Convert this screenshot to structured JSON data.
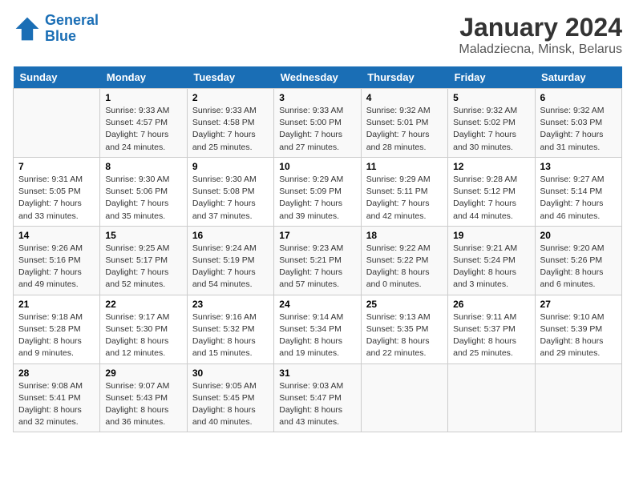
{
  "logo": {
    "line1": "General",
    "line2": "Blue"
  },
  "title": "January 2024",
  "subtitle": "Maladziecna, Minsk, Belarus",
  "days_of_week": [
    "Sunday",
    "Monday",
    "Tuesday",
    "Wednesday",
    "Thursday",
    "Friday",
    "Saturday"
  ],
  "weeks": [
    [
      {
        "day": "",
        "sunrise": "",
        "sunset": "",
        "daylight": ""
      },
      {
        "day": "1",
        "sunrise": "Sunrise: 9:33 AM",
        "sunset": "Sunset: 4:57 PM",
        "daylight": "Daylight: 7 hours and 24 minutes."
      },
      {
        "day": "2",
        "sunrise": "Sunrise: 9:33 AM",
        "sunset": "Sunset: 4:58 PM",
        "daylight": "Daylight: 7 hours and 25 minutes."
      },
      {
        "day": "3",
        "sunrise": "Sunrise: 9:33 AM",
        "sunset": "Sunset: 5:00 PM",
        "daylight": "Daylight: 7 hours and 27 minutes."
      },
      {
        "day": "4",
        "sunrise": "Sunrise: 9:32 AM",
        "sunset": "Sunset: 5:01 PM",
        "daylight": "Daylight: 7 hours and 28 minutes."
      },
      {
        "day": "5",
        "sunrise": "Sunrise: 9:32 AM",
        "sunset": "Sunset: 5:02 PM",
        "daylight": "Daylight: 7 hours and 30 minutes."
      },
      {
        "day": "6",
        "sunrise": "Sunrise: 9:32 AM",
        "sunset": "Sunset: 5:03 PM",
        "daylight": "Daylight: 7 hours and 31 minutes."
      }
    ],
    [
      {
        "day": "7",
        "sunrise": "Sunrise: 9:31 AM",
        "sunset": "Sunset: 5:05 PM",
        "daylight": "Daylight: 7 hours and 33 minutes."
      },
      {
        "day": "8",
        "sunrise": "Sunrise: 9:30 AM",
        "sunset": "Sunset: 5:06 PM",
        "daylight": "Daylight: 7 hours and 35 minutes."
      },
      {
        "day": "9",
        "sunrise": "Sunrise: 9:30 AM",
        "sunset": "Sunset: 5:08 PM",
        "daylight": "Daylight: 7 hours and 37 minutes."
      },
      {
        "day": "10",
        "sunrise": "Sunrise: 9:29 AM",
        "sunset": "Sunset: 5:09 PM",
        "daylight": "Daylight: 7 hours and 39 minutes."
      },
      {
        "day": "11",
        "sunrise": "Sunrise: 9:29 AM",
        "sunset": "Sunset: 5:11 PM",
        "daylight": "Daylight: 7 hours and 42 minutes."
      },
      {
        "day": "12",
        "sunrise": "Sunrise: 9:28 AM",
        "sunset": "Sunset: 5:12 PM",
        "daylight": "Daylight: 7 hours and 44 minutes."
      },
      {
        "day": "13",
        "sunrise": "Sunrise: 9:27 AM",
        "sunset": "Sunset: 5:14 PM",
        "daylight": "Daylight: 7 hours and 46 minutes."
      }
    ],
    [
      {
        "day": "14",
        "sunrise": "Sunrise: 9:26 AM",
        "sunset": "Sunset: 5:16 PM",
        "daylight": "Daylight: 7 hours and 49 minutes."
      },
      {
        "day": "15",
        "sunrise": "Sunrise: 9:25 AM",
        "sunset": "Sunset: 5:17 PM",
        "daylight": "Daylight: 7 hours and 52 minutes."
      },
      {
        "day": "16",
        "sunrise": "Sunrise: 9:24 AM",
        "sunset": "Sunset: 5:19 PM",
        "daylight": "Daylight: 7 hours and 54 minutes."
      },
      {
        "day": "17",
        "sunrise": "Sunrise: 9:23 AM",
        "sunset": "Sunset: 5:21 PM",
        "daylight": "Daylight: 7 hours and 57 minutes."
      },
      {
        "day": "18",
        "sunrise": "Sunrise: 9:22 AM",
        "sunset": "Sunset: 5:22 PM",
        "daylight": "Daylight: 8 hours and 0 minutes."
      },
      {
        "day": "19",
        "sunrise": "Sunrise: 9:21 AM",
        "sunset": "Sunset: 5:24 PM",
        "daylight": "Daylight: 8 hours and 3 minutes."
      },
      {
        "day": "20",
        "sunrise": "Sunrise: 9:20 AM",
        "sunset": "Sunset: 5:26 PM",
        "daylight": "Daylight: 8 hours and 6 minutes."
      }
    ],
    [
      {
        "day": "21",
        "sunrise": "Sunrise: 9:18 AM",
        "sunset": "Sunset: 5:28 PM",
        "daylight": "Daylight: 8 hours and 9 minutes."
      },
      {
        "day": "22",
        "sunrise": "Sunrise: 9:17 AM",
        "sunset": "Sunset: 5:30 PM",
        "daylight": "Daylight: 8 hours and 12 minutes."
      },
      {
        "day": "23",
        "sunrise": "Sunrise: 9:16 AM",
        "sunset": "Sunset: 5:32 PM",
        "daylight": "Daylight: 8 hours and 15 minutes."
      },
      {
        "day": "24",
        "sunrise": "Sunrise: 9:14 AM",
        "sunset": "Sunset: 5:34 PM",
        "daylight": "Daylight: 8 hours and 19 minutes."
      },
      {
        "day": "25",
        "sunrise": "Sunrise: 9:13 AM",
        "sunset": "Sunset: 5:35 PM",
        "daylight": "Daylight: 8 hours and 22 minutes."
      },
      {
        "day": "26",
        "sunrise": "Sunrise: 9:11 AM",
        "sunset": "Sunset: 5:37 PM",
        "daylight": "Daylight: 8 hours and 25 minutes."
      },
      {
        "day": "27",
        "sunrise": "Sunrise: 9:10 AM",
        "sunset": "Sunset: 5:39 PM",
        "daylight": "Daylight: 8 hours and 29 minutes."
      }
    ],
    [
      {
        "day": "28",
        "sunrise": "Sunrise: 9:08 AM",
        "sunset": "Sunset: 5:41 PM",
        "daylight": "Daylight: 8 hours and 32 minutes."
      },
      {
        "day": "29",
        "sunrise": "Sunrise: 9:07 AM",
        "sunset": "Sunset: 5:43 PM",
        "daylight": "Daylight: 8 hours and 36 minutes."
      },
      {
        "day": "30",
        "sunrise": "Sunrise: 9:05 AM",
        "sunset": "Sunset: 5:45 PM",
        "daylight": "Daylight: 8 hours and 40 minutes."
      },
      {
        "day": "31",
        "sunrise": "Sunrise: 9:03 AM",
        "sunset": "Sunset: 5:47 PM",
        "daylight": "Daylight: 8 hours and 43 minutes."
      },
      {
        "day": "",
        "sunrise": "",
        "sunset": "",
        "daylight": ""
      },
      {
        "day": "",
        "sunrise": "",
        "sunset": "",
        "daylight": ""
      },
      {
        "day": "",
        "sunrise": "",
        "sunset": "",
        "daylight": ""
      }
    ]
  ]
}
